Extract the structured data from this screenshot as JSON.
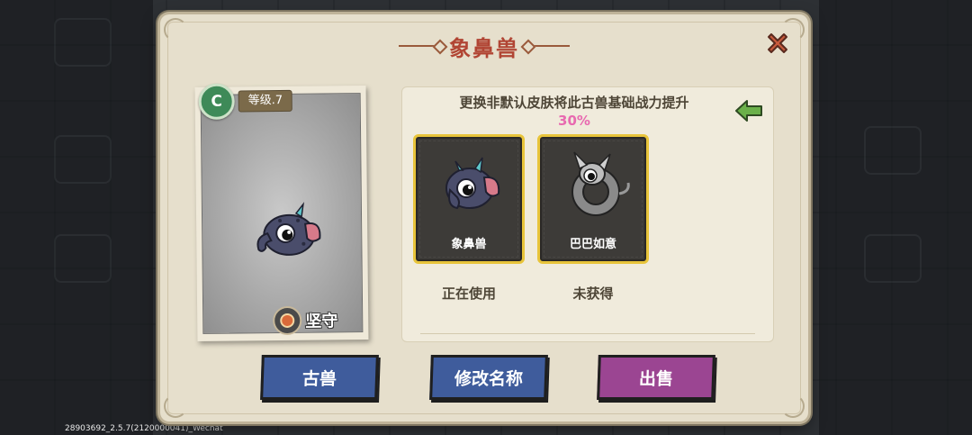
{
  "dialog": {
    "title": "象鼻兽"
  },
  "pet_card": {
    "grade": "C",
    "level": "等级.7",
    "trait": "坚守"
  },
  "skin_panel": {
    "description": "更换非默认皮肤将此古兽基础战力提升",
    "bonus_percent": "30%",
    "skins": [
      {
        "name": "象鼻兽",
        "status": "正在使用"
      },
      {
        "name": "巴巴如意",
        "status": "未获得"
      }
    ]
  },
  "buttons": {
    "beast_label": "古兽",
    "rename_label": "修改名称",
    "sell_label": "出售"
  },
  "footer": {
    "version": "28903692_2.5.7(2120000041)_Wechat"
  },
  "colors": {
    "title": "#b14534",
    "percent": "#e86ab0",
    "frame_gold": "#e8c43a",
    "button_blue": "#3f5c9c",
    "button_purple": "#9b4592",
    "grade_green": "#3e8a58"
  }
}
